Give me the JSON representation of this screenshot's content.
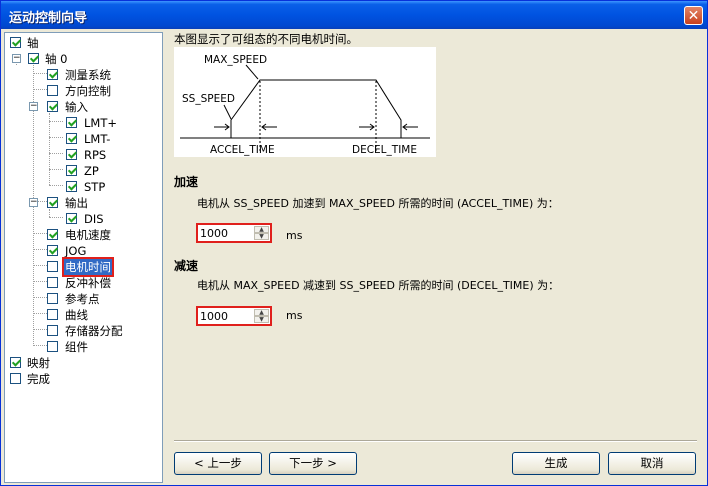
{
  "window": {
    "title": "运动控制向导",
    "close_glyph": "✕"
  },
  "tree": {
    "items": [
      {
        "label": "轴",
        "checked": true
      },
      {
        "label": "轴 0",
        "checked": true
      },
      {
        "label": "测量系统",
        "checked": true
      },
      {
        "label": "方向控制",
        "checked": false
      },
      {
        "label": "输入",
        "checked": true
      },
      {
        "label": "LMT+",
        "checked": true
      },
      {
        "label": "LMT-",
        "checked": true
      },
      {
        "label": "RPS",
        "checked": true
      },
      {
        "label": "ZP",
        "checked": true
      },
      {
        "label": "STP",
        "checked": true
      },
      {
        "label": "输出",
        "checked": true
      },
      {
        "label": "DIS",
        "checked": true
      },
      {
        "label": "电机速度",
        "checked": true
      },
      {
        "label": "JOG",
        "checked": true
      },
      {
        "label": "电机时间",
        "checked": false,
        "selected": true
      },
      {
        "label": "反冲补偿",
        "checked": false
      },
      {
        "label": "参考点",
        "checked": false
      },
      {
        "label": "曲线",
        "checked": false
      },
      {
        "label": "存储器分配",
        "checked": false
      },
      {
        "label": "组件",
        "checked": false
      },
      {
        "label": "映射",
        "checked": true
      },
      {
        "label": "完成",
        "checked": false
      }
    ]
  },
  "content": {
    "description": "本图显示了可组态的不同电机时间。",
    "diagram": {
      "max_speed_label": "MAX_SPEED",
      "ss_speed_label": "SS_SPEED",
      "accel_label": "ACCEL_TIME",
      "decel_label": "DECEL_TIME"
    },
    "accel": {
      "title": "加速",
      "desc": "电机从 SS_SPEED 加速到 MAX_SPEED 所需的时间 (ACCEL_TIME) 为：",
      "value": "1000",
      "unit": "ms"
    },
    "decel": {
      "title": "减速",
      "desc": "电机从 MAX_SPEED 减速到 SS_SPEED 所需的时间 (DECEL_TIME) 为：",
      "value": "1000",
      "unit": "ms"
    }
  },
  "footer": {
    "prev_label": "< 上一步",
    "next_label": "下一步 >",
    "finish_label": "生成",
    "cancel_label": "取消"
  },
  "colors": {
    "titlebar": "#0053e1",
    "selection": "#316ac5",
    "highlight_border": "#e0201c"
  }
}
